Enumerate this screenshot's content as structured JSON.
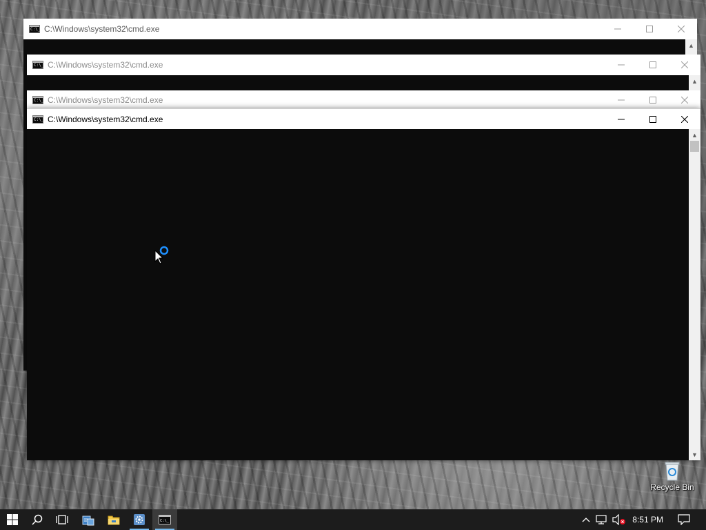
{
  "windows": [
    {
      "title": "C:\\Windows\\system32\\cmd.exe"
    },
    {
      "title": "C:\\Windows\\system32\\cmd.exe"
    },
    {
      "title": "C:\\Windows\\system32\\cmd.exe"
    },
    {
      "title": "C:\\Windows\\system32\\cmd.exe"
    }
  ],
  "desktop": {
    "recycle_bin_label": "Recycle Bin"
  },
  "taskbar": {
    "icons": [
      "windows-start-icon",
      "search-icon",
      "task-view-icon",
      "server-manager-icon",
      "file-explorer-icon",
      "settings-app-icon",
      "cmd-app-icon"
    ],
    "tray_icons": [
      "chevron-up-icon",
      "network-icon",
      "volume-muted-icon",
      "action-center-icon"
    ],
    "clock": "8:51 PM"
  },
  "colors": {
    "console_bg": "#0c0c0c",
    "titlebar_bg": "#ffffff",
    "taskbar_bg": "#1c1c1c",
    "accent": "#76b9ed"
  }
}
